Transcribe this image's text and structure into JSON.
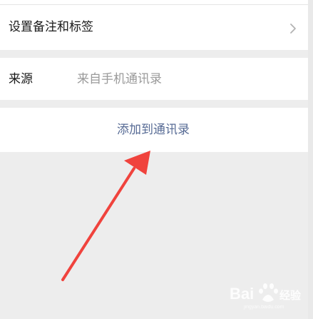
{
  "remark_row": {
    "label": "设置备注和标签",
    "chevron_icon": "chevron-right-icon"
  },
  "source_row": {
    "label": "来源",
    "value": "来自手机通讯录"
  },
  "add_contact": {
    "label": "添加到通讯录"
  },
  "annotation": {
    "arrow_color": "#f0433d"
  },
  "watermark": {
    "text": "Baidu 经验"
  }
}
